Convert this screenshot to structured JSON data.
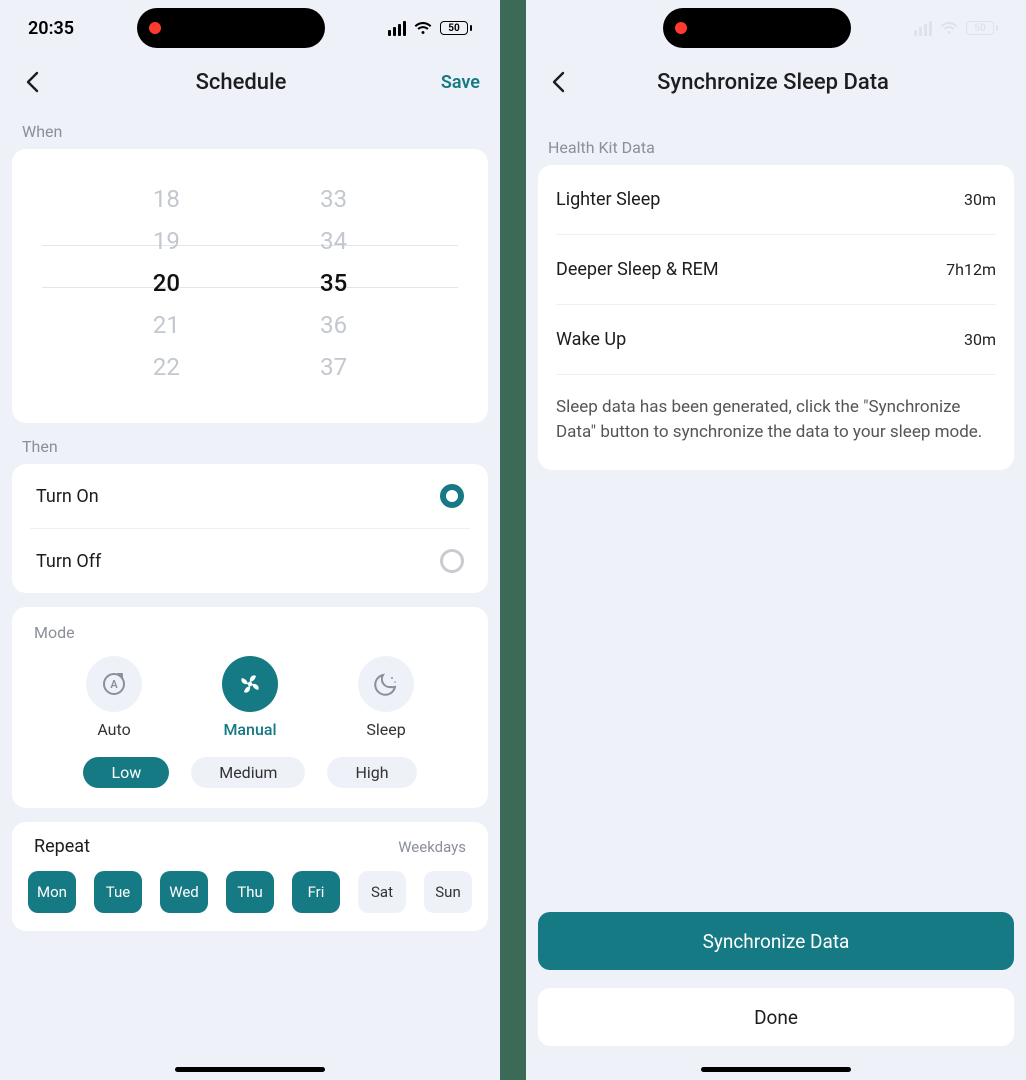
{
  "status": {
    "time": "20:35",
    "battery": "50"
  },
  "left": {
    "title": "Schedule",
    "save": "Save",
    "when_label": "When",
    "picker": {
      "hours": [
        "18",
        "19",
        "20",
        "21",
        "22"
      ],
      "minutes": [
        "33",
        "34",
        "35",
        "36",
        "37"
      ]
    },
    "then_label": "Then",
    "actions": {
      "on": "Turn On",
      "off": "Turn Off"
    },
    "mode_label": "Mode",
    "modes": {
      "auto": "Auto",
      "manual": "Manual",
      "sleep": "Sleep"
    },
    "speeds": {
      "low": "Low",
      "medium": "Medium",
      "high": "High"
    },
    "repeat": {
      "title": "Repeat",
      "summary": "Weekdays",
      "days": [
        "Mon",
        "Tue",
        "Wed",
        "Thu",
        "Fri",
        "Sat",
        "Sun"
      ]
    }
  },
  "right": {
    "title": "Synchronize Sleep Data",
    "section": "Health Kit Data",
    "rows": [
      {
        "label": "Lighter Sleep",
        "value": "30m"
      },
      {
        "label": "Deeper Sleep & REM",
        "value": "7h12m"
      },
      {
        "label": "Wake Up",
        "value": "30m"
      }
    ],
    "note": "Sleep data has been generated, click the \"Synchronize Data\" button to synchronize the data to your sleep mode.",
    "primary": "Synchronize Data",
    "secondary": "Done"
  }
}
